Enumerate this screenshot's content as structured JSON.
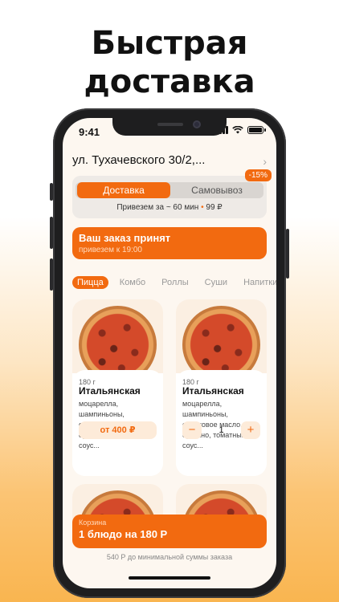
{
  "headline": {
    "line1": "Быстрая",
    "line2": "доставка"
  },
  "status": {
    "time": "9:41"
  },
  "address": {
    "text": "ул. Тухачевского 30/2,..."
  },
  "delivery_mode": {
    "active": "Доставка",
    "inactive": "Самовывоз",
    "discount": "-15%",
    "eta": "Привезем за ~ 60 мин",
    "separator": "•",
    "fee": "99 ₽"
  },
  "order_banner": {
    "title": "Ваш заказ принят",
    "subtitle": "привезем к 19:00"
  },
  "categories": [
    "Пицца",
    "Комбо",
    "Роллы",
    "Суши",
    "Напитки"
  ],
  "products": [
    {
      "weight": "180 г",
      "name": "Итальянская",
      "desc": "моцарелла, шампиньоны, оливковое масло, орегано, томатный соус...",
      "price": "от 400 ₽"
    },
    {
      "weight": "180 г",
      "name": "Итальянская",
      "desc": "моцарелла, шампиньоны, оливковое масло, орегано, томатный соус...",
      "qty": "1",
      "minus": "−",
      "plus": "+"
    }
  ],
  "cart": {
    "label": "Корзина",
    "summary": "1 блюдо на 180 Р"
  },
  "min_order_note": "540 Р до минимальной суммы заказа",
  "colors": {
    "accent": "#f26a10",
    "screen_bg": "#fdf7f0"
  }
}
